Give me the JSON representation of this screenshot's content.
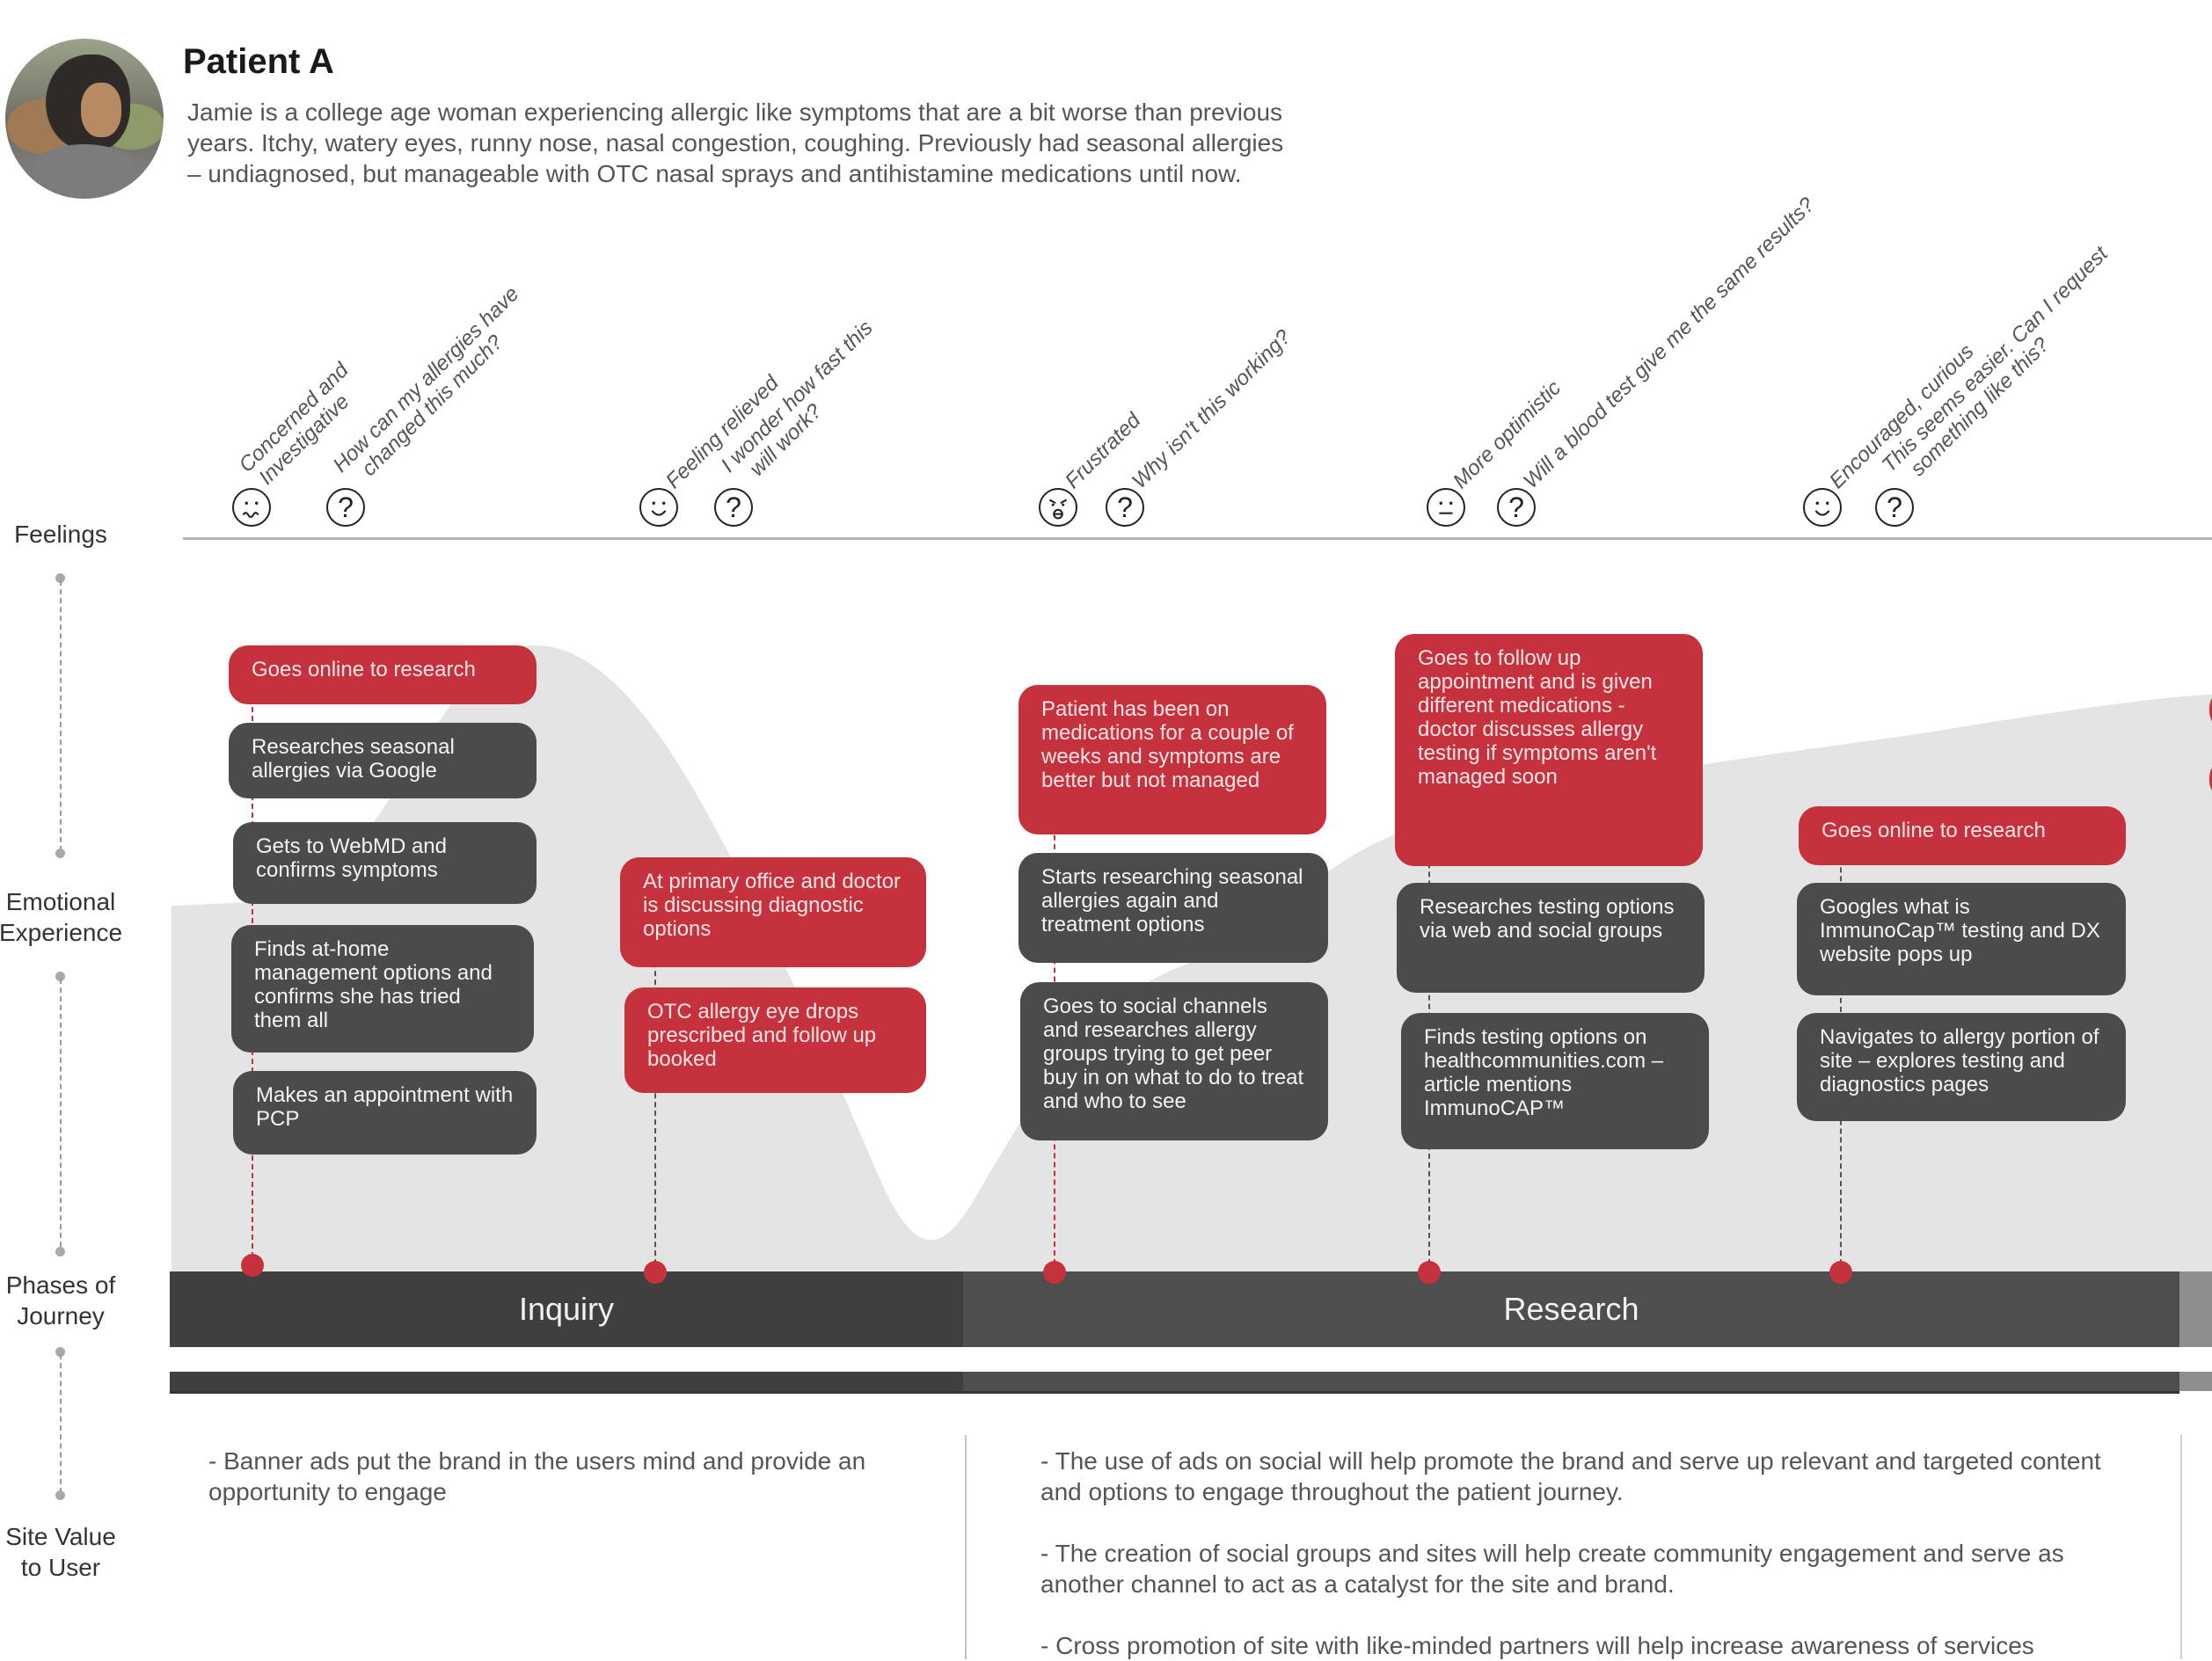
{
  "persona": {
    "title": "Patient A",
    "avatar_icon": "persona-photo",
    "description": "Jamie is a college age woman experiencing allergic like symptoms that are a bit worse than previous years. Itchy, watery eyes, runny nose, nasal congestion, coughing. Previously had seasonal allergies – undiagnosed, but manageable with OTC nasal sprays and antihistamine medications until now."
  },
  "row_labels": {
    "feelings": "Feelings",
    "emotional_1": "Emotional",
    "emotional_2": "Experience",
    "phases_1": "Phases of",
    "phases_2": "Journey",
    "site_value_1": "Site Value",
    "site_value_2": "to User"
  },
  "feelings": [
    {
      "mood_icon": "worried-face-icon",
      "mood": "Concerned and Investigative",
      "question": "How can my allergies have changed this much?"
    },
    {
      "mood_icon": "smiling-face-icon",
      "mood": "Feeling relieved",
      "question": "I wonder how fast this will work?"
    },
    {
      "mood_icon": "angry-face-icon",
      "mood": "Frustrated",
      "question": "Why isn't this working?"
    },
    {
      "mood_icon": "neutral-face-icon",
      "mood": "More optimistic",
      "question": "Will a blood test give me the same results?"
    },
    {
      "mood_icon": "smiling-face-icon",
      "mood": "Encouraged, curious",
      "question": "This seems easier. Can I request something like this?"
    }
  ],
  "question_icon": "?",
  "touchpoints": [
    {
      "cards": [
        {
          "type": "red",
          "text": "Goes online to research"
        },
        {
          "type": "dark",
          "text": "Researches seasonal allergies via Google"
        },
        {
          "type": "dark",
          "text": "Gets to WebMD and confirms symptoms"
        },
        {
          "type": "dark",
          "text": "Finds at-home management options and confirms she has tried them all"
        },
        {
          "type": "dark",
          "text": "Makes an appointment with PCP"
        }
      ]
    },
    {
      "cards": [
        {
          "type": "red",
          "text": "At primary office and doctor is discussing diagnostic options"
        },
        {
          "type": "red",
          "text": "OTC allergy eye drops prescribed and follow up booked"
        }
      ]
    },
    {
      "cards": [
        {
          "type": "red",
          "text": "Patient has been on medications for a couple of weeks and symptoms are better but not managed"
        },
        {
          "type": "dark",
          "text": "Starts researching seasonal allergies again and treatment options"
        },
        {
          "type": "dark",
          "text": "Goes to social channels and researches allergy groups trying to get peer buy in on what to do to treat and who to see"
        }
      ]
    },
    {
      "cards": [
        {
          "type": "red",
          "text": "Goes to follow up appointment and is given different medications - doctor discusses allergy testing if symptoms aren't managed soon"
        },
        {
          "type": "dark",
          "text": "Researches testing options via web and social groups"
        },
        {
          "type": "dark",
          "text": "Finds testing options on healthcommunities.com – article mentions ImmunoCAP™"
        }
      ]
    },
    {
      "cards": [
        {
          "type": "red",
          "text": "Goes online to research"
        },
        {
          "type": "dark",
          "text": "Googles what is ImmunoCap™ testing and DX website pops up"
        },
        {
          "type": "dark",
          "text": "Navigates to allergy portion of site – explores testing and diagnostics pages"
        }
      ]
    }
  ],
  "phases": [
    {
      "label": "Inquiry"
    },
    {
      "label": "Research"
    }
  ],
  "site_value": {
    "inquiry": [
      "- Banner ads put the brand in the users mind and provide an opportunity to engage"
    ],
    "research": [
      "-  The use of ads on social will help promote the brand and serve up relevant and targeted content and options to engage throughout the patient journey.",
      "- The creation of social groups and sites will help create community engagement and serve as another channel to act as a catalyst for the site and brand.",
      "- Cross promotion of site with like-minded partners will help increase awareness of services"
    ]
  },
  "colors": {
    "accent_red": "#c5323e",
    "card_dark": "#4b4b4b",
    "phase_inquiry": "#3f3f3f",
    "phase_research": "#4e4e4e",
    "curve_fill": "#e4e4e4"
  }
}
